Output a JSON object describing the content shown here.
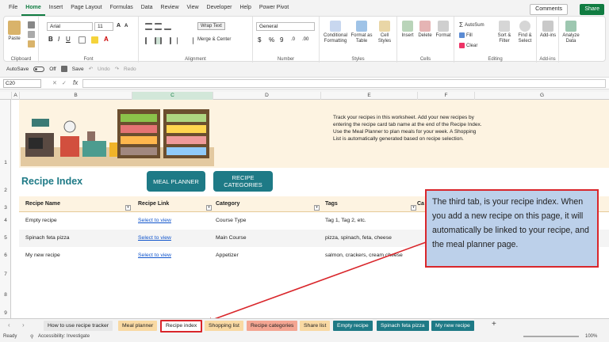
{
  "menu": [
    "File",
    "Home",
    "Insert",
    "Page Layout",
    "Formulas",
    "Data",
    "Review",
    "View",
    "Developer",
    "Help",
    "Power Pivot"
  ],
  "menu_active": "Home",
  "header_buttons": {
    "comments": "Comments",
    "share": "Share"
  },
  "ribbon": {
    "clipboard": {
      "paste": "Paste",
      "label": "Clipboard"
    },
    "font": {
      "name": "Arial",
      "size": "11",
      "label": "Font"
    },
    "alignment": {
      "wrap_text": "Wrap Text",
      "merge": "Merge & Center",
      "label": "Alignment"
    },
    "number": {
      "format": "General",
      "label": "Number"
    },
    "styles": {
      "conditional": "Conditional Formatting",
      "format_as_table": "Format as Table",
      "cell_styles": "Cell Styles",
      "label": "Styles"
    },
    "cells": {
      "insert": "Insert",
      "delete": "Delete",
      "format": "Format",
      "label": "Cells"
    },
    "editing": {
      "autosum": "AutoSum",
      "fill": "Fill",
      "clear": "Clear",
      "sort": "Sort & Filter",
      "find": "Find & Select",
      "label": "Editing"
    },
    "addins": {
      "addins": "Add-ins",
      "label": "Add-ins"
    },
    "analyze": {
      "label": "Analyze Data"
    }
  },
  "qat": {
    "autosave": "AutoSave",
    "toggle": "Off",
    "save": "Save",
    "undo": "Undo",
    "redo": "Redo"
  },
  "formula_bar": {
    "cell": "C20",
    "fx": "fx"
  },
  "columns": [
    "A",
    "B",
    "C",
    "D",
    "E",
    "F",
    "G"
  ],
  "selected_column": "C",
  "rows": [
    "1",
    "2",
    "3",
    "4",
    "5",
    "6",
    "7",
    "8",
    "9"
  ],
  "intro_text": "Track your recipes in this worksheet. Add your new recipes by entering the recipe card tab name at the end of the Recipe Index. Use the Meal Planner to plan meals for your week. A Shopping List is automatically generated based on recipe selection.",
  "page_title": "Recipe Index",
  "buttons": {
    "meal_planner": "MEAL PLANNER",
    "recipe_categories": "RECIPE CATEGORIES"
  },
  "table": {
    "headers": [
      "Recipe Name",
      "Recipe Link",
      "Category",
      "Tags",
      "Ca"
    ],
    "rows": [
      {
        "name": "Empty recipe",
        "link": "Select to view",
        "category": "Course Type",
        "tags": "Tag 1, Tag 2, etc."
      },
      {
        "name": "Spinach feta pizza",
        "link": "Select to view",
        "category": "Main Course",
        "tags": "pizza, spinach, feta, cheese"
      },
      {
        "name": "My new recipe",
        "link": "Select to view",
        "category": "Appetizer",
        "tags": "salmon, crackers, cream cheese"
      }
    ]
  },
  "callout": "The third tab, is your recipe index. When you add a new recipe on this page, it will automatically be linked to your recipe, and the meal planner page.",
  "tabs": [
    {
      "label": "How to use recipe tracker",
      "bg": "#e6e6e6",
      "fg": "#222222"
    },
    {
      "label": "Meal planner",
      "bg": "#f9d9a3",
      "fg": "#222222"
    },
    {
      "label": "Recipe index",
      "bg": "#ffffff",
      "fg": "#222222",
      "active": true
    },
    {
      "label": "Shopping list",
      "bg": "#f9d9a3",
      "fg": "#222222"
    },
    {
      "label": "Recipe categories",
      "bg": "#f4a592",
      "fg": "#222222"
    },
    {
      "label": "Share list",
      "bg": "#f9d9a3",
      "fg": "#222222"
    },
    {
      "label": "Empty recipe",
      "bg": "#1e7a86",
      "fg": "#ffffff"
    },
    {
      "label": "Spinach feta pizza",
      "bg": "#1e7a86",
      "fg": "#ffffff"
    },
    {
      "label": "My new recipe",
      "bg": "#1e7a86",
      "fg": "#ffffff"
    }
  ],
  "add_sheet": "+",
  "status": {
    "ready": "Ready",
    "accessibility": "Accessibility: Investigate",
    "zoom": "100%"
  },
  "colors": {
    "accent": "#107c41",
    "teal": "#1e7a86",
    "callout_border": "#d9262b",
    "callout_bg": "#bcd0ea"
  }
}
